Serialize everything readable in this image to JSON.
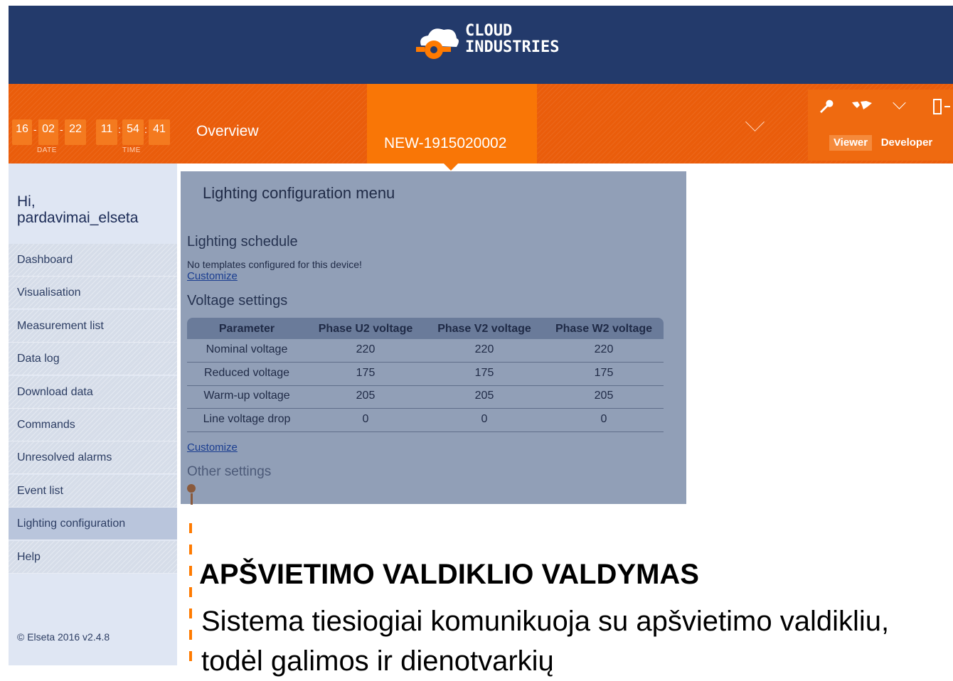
{
  "brand": {
    "line1": "CLOUD",
    "line2": "INDUSTRIES"
  },
  "clock": {
    "date": [
      "16",
      "02",
      "22"
    ],
    "time": [
      "11",
      "54",
      "41"
    ],
    "date_label": "DATE",
    "time_label": "TIME"
  },
  "tabs": {
    "overview": "Overview",
    "device": "NEW-1915020002"
  },
  "roles": {
    "viewer": "Viewer",
    "developer": "Developer"
  },
  "greeting": {
    "hi": "Hi,",
    "user": "pardavimai_elseta"
  },
  "nav": {
    "items": [
      {
        "label": "Dashboard"
      },
      {
        "label": "Visualisation"
      },
      {
        "label": "Measurement list"
      },
      {
        "label": "Data log"
      },
      {
        "label": "Download data"
      },
      {
        "label": "Commands"
      },
      {
        "label": "Unresolved alarms"
      },
      {
        "label": "Event list"
      },
      {
        "label": "Lighting configuration"
      },
      {
        "label": "Help"
      }
    ],
    "active_index": 8
  },
  "copyright": "© Elseta 2016 v2.4.8",
  "panel": {
    "title": "Lighting configuration menu",
    "schedule_heading": "Lighting schedule",
    "schedule_message": "No templates configured for this device!",
    "customize_label": "Customize",
    "voltage_heading": "Voltage settings",
    "other_heading": "Other settings"
  },
  "voltage_table": {
    "headers": [
      "Parameter",
      "Phase U2 voltage",
      "Phase V2 voltage",
      "Phase W2 voltage"
    ],
    "rows": [
      [
        "Nominal voltage",
        "220",
        "220",
        "220"
      ],
      [
        "Reduced voltage",
        "175",
        "175",
        "175"
      ],
      [
        "Warm-up voltage",
        "205",
        "205",
        "205"
      ],
      [
        "Line voltage drop",
        "0",
        "0",
        "0"
      ]
    ]
  },
  "slide_text": {
    "title": "APŠVIETIMO VALDIKLIO VALDYMAS",
    "body": "Sistema tiesiogiai komunikuoja su apšvietimo valdikliu, todėl galimos ir dienotvarkių"
  },
  "icons": [
    "wrench-icon",
    "world-map-icon",
    "chevron-down-icon",
    "logout-icon",
    "map-pin-icon"
  ],
  "colors": {
    "header_navy": "#233a6b",
    "orange": "#ea5d0b",
    "active_tab": "#f97606",
    "panel": "#919fb7",
    "sidebar": "#dfe6f3"
  }
}
